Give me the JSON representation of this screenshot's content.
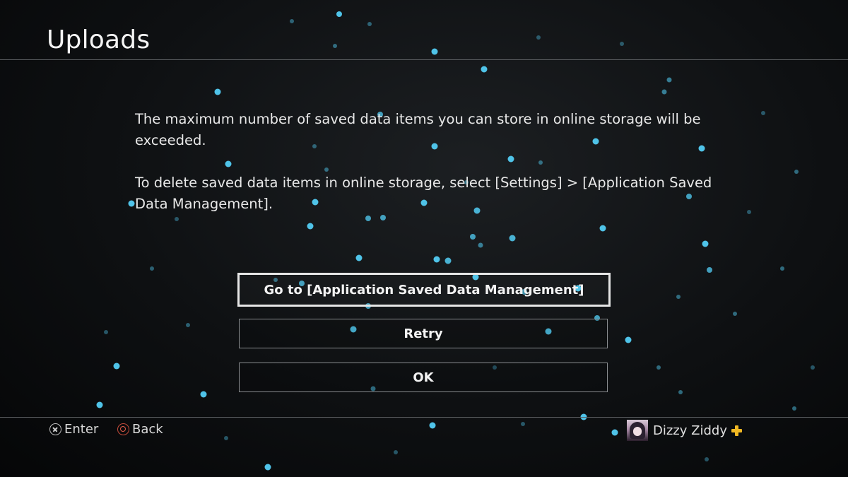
{
  "header": {
    "title": "Uploads"
  },
  "dialog": {
    "message_1": "The maximum number of saved data items you can store in online storage will be exceeded.",
    "message_2": "To delete saved data items in online storage, select [Settings] > [Application Saved Data Management]."
  },
  "buttons": {
    "go_to_label": "Go to [Application Saved Data Management]",
    "retry_label": "Retry",
    "ok_label": "OK"
  },
  "footer": {
    "enter_label": "Enter",
    "back_label": "Back",
    "enter_icon": "cross-button-icon",
    "back_icon": "circle-button-icon"
  },
  "user": {
    "name": "Dizzy Ziddy",
    "badge_icon": "playstation-plus-icon"
  },
  "colors": {
    "particle": "#4fc3e8",
    "plus_badge": "#f0b823",
    "back_glyph": "#e05a46"
  }
}
